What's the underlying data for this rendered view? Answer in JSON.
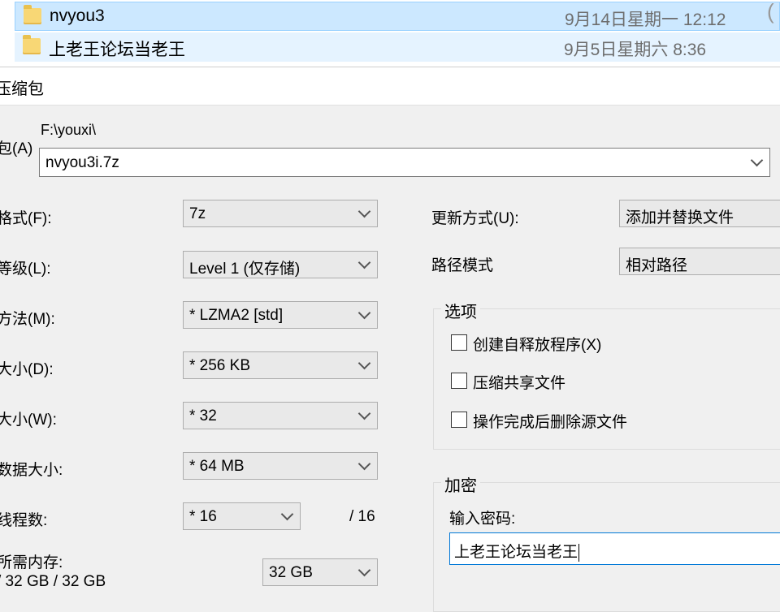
{
  "files": [
    {
      "name": "nvyou3",
      "date": "9月14日星期一 12:12",
      "extra": "(",
      "selected": true
    },
    {
      "name": "上老王论坛当老王",
      "date": "9月5日星期六 8:36",
      "selected": false
    }
  ],
  "dialog": {
    "title": "压缩包",
    "archive": {
      "label": "包(A)",
      "path": "F:\\youxi\\",
      "value": "nvyou3i.7z"
    },
    "format": {
      "label": "格式(F):",
      "value": "7z"
    },
    "level": {
      "label": "等级(L):",
      "value": "Level 1 (仅存储)"
    },
    "method": {
      "label": "方法(M):",
      "value": "*  LZMA2 [std]"
    },
    "dict": {
      "label": "大小(D):",
      "value": "*  256 KB"
    },
    "word": {
      "label": "大小(W):",
      "value": "*  32"
    },
    "solid": {
      "label": "数据大小:",
      "value": "*  64 MB"
    },
    "threads": {
      "label": "线程数:",
      "value": "*  16",
      "max": "/ 16"
    },
    "memory": {
      "label": "所需内存:",
      "detail": "/ 32 GB / 32 GB",
      "value": "32 GB"
    },
    "update": {
      "label": "更新方式(U):",
      "value": "添加并替换文件"
    },
    "pathmode": {
      "label": "路径模式",
      "value": "相对路径"
    },
    "options": {
      "title": "选项",
      "sfx": "创建自释放程序(X)",
      "shared": "压缩共享文件",
      "delete": "操作完成后删除源文件"
    },
    "encryption": {
      "title": "加密",
      "password_label": "输入密码:",
      "password_value": "上老王论坛当老王"
    }
  }
}
